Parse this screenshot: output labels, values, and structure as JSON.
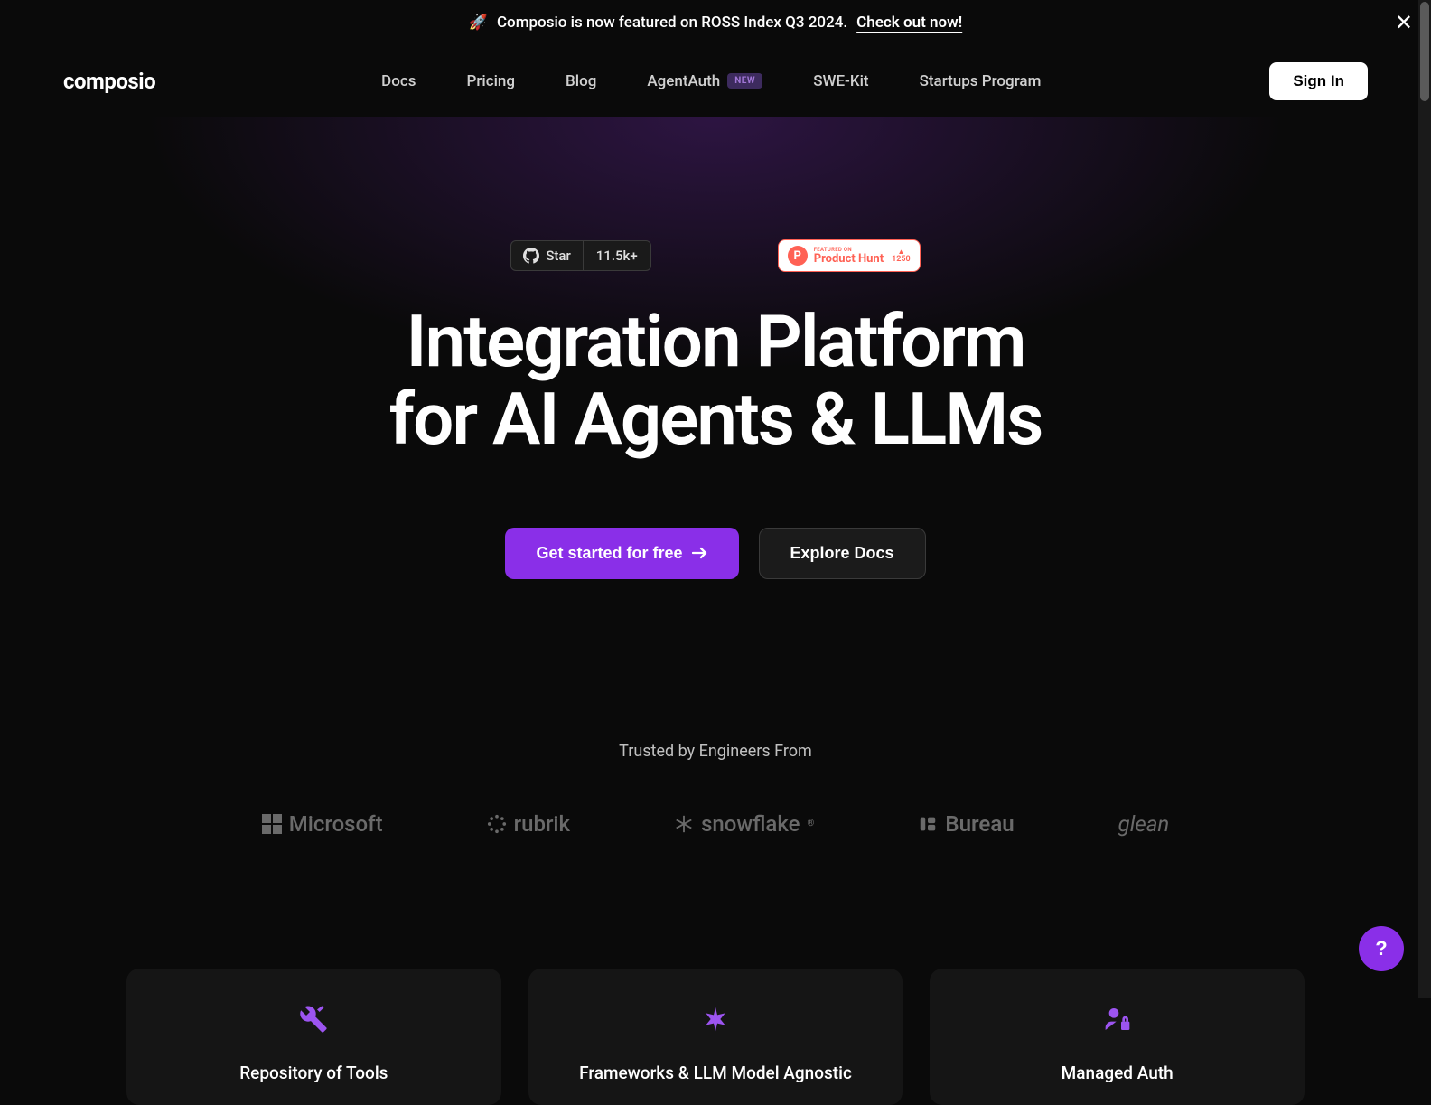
{
  "announcement": {
    "emoji": "🚀",
    "text": "Composio is now featured on ROSS Index Q3 2024.",
    "link_text": "Check out now!"
  },
  "brand": "composio",
  "nav": {
    "items": [
      {
        "label": "Docs"
      },
      {
        "label": "Pricing"
      },
      {
        "label": "Blog"
      },
      {
        "label": "AgentAuth",
        "badge": "NEW"
      },
      {
        "label": "SWE-Kit"
      },
      {
        "label": "Startups Program"
      }
    ],
    "sign_in": "Sign In"
  },
  "badges": {
    "github": {
      "star_label": "Star",
      "count": "11.5k+"
    },
    "product_hunt": {
      "featured_label": "FEATURED ON",
      "name": "Product Hunt",
      "upvotes": "1250"
    }
  },
  "hero": {
    "title_line1": "Integration Platform",
    "title_line2": "for AI Agents & LLMs",
    "cta_primary": "Get started for free",
    "cta_secondary": "Explore Docs"
  },
  "trusted": {
    "label": "Trusted by Engineers From",
    "companies": [
      {
        "name": "Microsoft"
      },
      {
        "name": "rubrik"
      },
      {
        "name": "snowflake"
      },
      {
        "name": "Bureau"
      },
      {
        "name": "glean"
      }
    ]
  },
  "features": [
    {
      "title": "Repository of Tools",
      "icon": "tools"
    },
    {
      "title": "Frameworks & LLM Model Agnostic",
      "icon": "asterisk"
    },
    {
      "title": "Managed Auth",
      "icon": "user-lock"
    }
  ],
  "help": "?"
}
